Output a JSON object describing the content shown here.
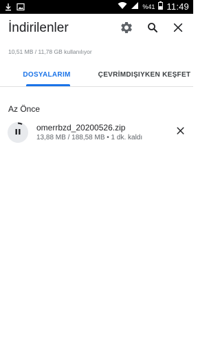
{
  "status_bar": {
    "time": "11:49",
    "battery_percent": "%41",
    "icons": [
      "download-icon",
      "image-icon",
      "wifi-icon",
      "signal-icon",
      "battery-icon"
    ]
  },
  "app_bar": {
    "title": "İndirilenler",
    "actions": [
      "settings-gear-icon",
      "search-icon",
      "close-icon"
    ]
  },
  "storage_text": "10,51 MB / 11,78 GB kullanılıyor",
  "tabs": [
    {
      "label": "DOSYALARIM",
      "selected": true
    },
    {
      "label": "ÇEVRİMDIŞIYKEN KEŞFET",
      "selected": false
    }
  ],
  "section": {
    "header": "Az Önce",
    "items": [
      {
        "file_name": "omerrbzd_20200526.zip",
        "meta": "13,88 MB / 188,58 MB • 1 dk. kaldı",
        "progress": 0.074
      }
    ]
  },
  "colors": {
    "accent": "#1a73e8",
    "text_primary": "#202124",
    "text_secondary": "#5f6368"
  }
}
